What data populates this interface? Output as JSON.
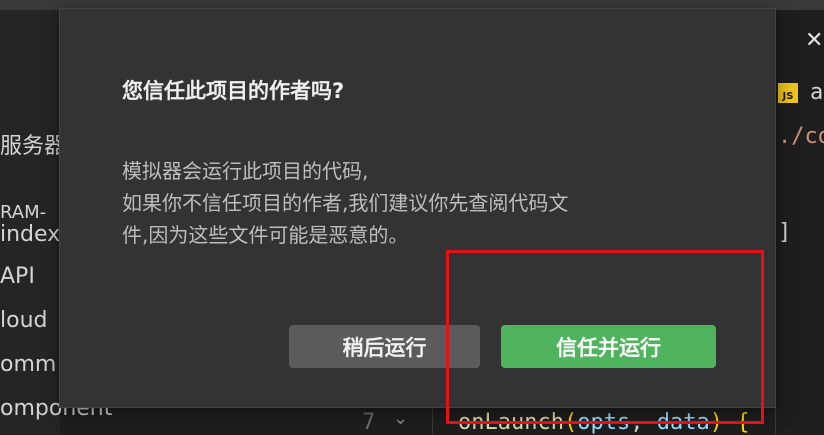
{
  "sidebar": {
    "items": [
      "服务器",
      "RAM-",
      "index",
      "API",
      "loud",
      "omm",
      "omponent"
    ]
  },
  "editor": {
    "close_glyph": "✕",
    "js_badge": "JS",
    "code_frag_1": "a",
    "code_frag_2": "./co",
    "code_frag_3": "]",
    "line_number": "7",
    "launch_fn": "onLaunch",
    "launch_p1": "opts",
    "launch_p2": "data",
    "launch_open": "(",
    "launch_comma": ", ",
    "launch_close": ")",
    "launch_brace": "{"
  },
  "dialog": {
    "title": "您信任此项目的作者吗?",
    "body": [
      "模拟器会运行此项目的代码,",
      "如果你不信任项目的作者,我们建议你先查阅代码文",
      "件,因为这些文件可能是恶意的。"
    ],
    "later_label": "稍后运行",
    "trust_label": "信任并运行"
  },
  "colors": {
    "trust_button": "#4fb45d",
    "later_button": "#5b5b5b",
    "annotation": "#e5111a"
  }
}
